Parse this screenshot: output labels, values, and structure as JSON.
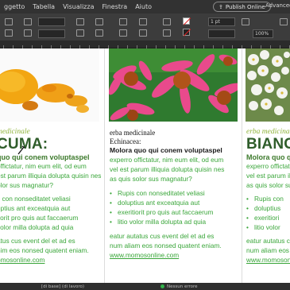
{
  "menu": {
    "items": [
      "ggetto",
      "Tabella",
      "Visualizza",
      "Finestra",
      "Aiuto"
    ],
    "publish_label": "Publish Online",
    "advanced_label": "Advanced"
  },
  "control": {
    "stroke_weight": "1 pt",
    "zoom": "100%"
  },
  "columns": [
    {
      "kicker": "medicinale",
      "title": "CUMA:",
      "subtitle": "quo qui conem voluptaspel",
      "body_lines": [
        "offictatur, nim eum elit, od eum",
        "est parum illiquia dolupta quisin nes",
        "olor sus magnatur?"
      ],
      "bullets": [
        "s con nonseditatet veliasi",
        "uptius ant exceatquia aut",
        "itorit pro quis aut faccaerum",
        "volor milla dolupta ad quia"
      ],
      "footer_lines": [
        "atus cus event del et ad es",
        "nim eos nonsed quatent eniam."
      ],
      "link": "omosonline.com"
    },
    {
      "raw_lines": [
        "erba medicinale",
        "Echinacea:"
      ],
      "subtitle": "Molora quo qui conem voluptaspel",
      "body_lines": [
        "experro offictatur, nim eum elit, od eum",
        "vel est parum illiquia dolupta quisin nes",
        "as quis solor sus magnatur?"
      ],
      "bullets": [
        "Rupis con nonseditatet veliasi",
        "doluptius ant exceatquia aut",
        "exeritiorit pro quis aut faccaerum",
        "litio volor milla dolupta ad quia"
      ],
      "footer_lines": [
        "eatur autatus cus event del et ad es",
        "num aliam eos nonsed quatent eniam."
      ],
      "link": "www.momosonline.com"
    },
    {
      "kicker": "erba medicinale",
      "title": "BIANCO",
      "subtitle": "Molora quo q",
      "body_lines": [
        "experro offictat",
        "vel est parum il",
        "as quis solor su"
      ],
      "bullets": [
        "Rupis con",
        "doluptius",
        "exeritiori",
        "litio volor"
      ],
      "footer_lines": [
        "eatur autatus c",
        "num aliam eos"
      ],
      "link": "www.momosonl"
    }
  ],
  "status": {
    "left_text": "[di base] (di lavoro)",
    "right_text": "Nessun errore"
  }
}
